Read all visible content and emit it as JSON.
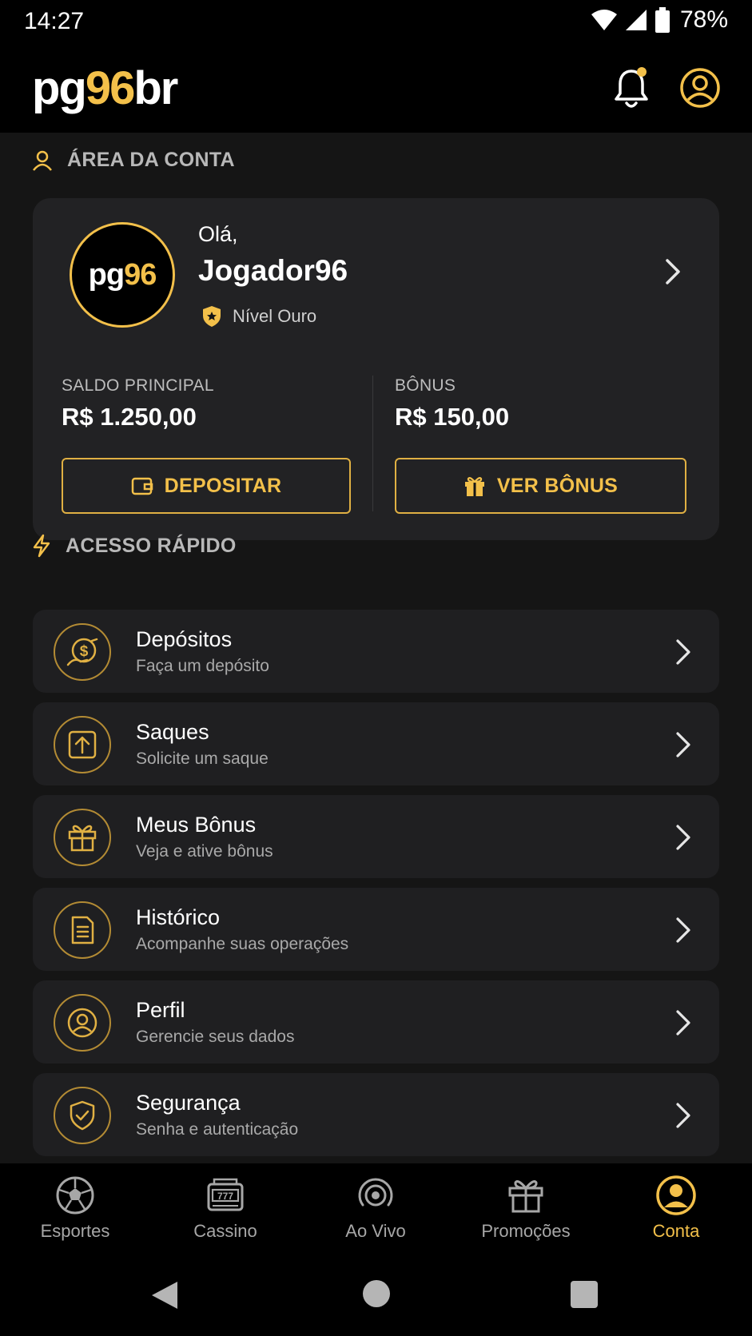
{
  "status": {
    "time": "14:27",
    "battery": "78%"
  },
  "app": {
    "logo_a": "pg",
    "logo_b": "96",
    "logo_c": "br"
  },
  "colors": {
    "accent": "#f3c04a",
    "background": "#151515",
    "card": "#222224"
  },
  "account": {
    "section_title": "ÁREA DA CONTA",
    "avatar_a": "pg",
    "avatar_b": "96",
    "greeting": "Olá,",
    "username": "Jogador96",
    "level": "Nível Ouro",
    "main_balance_label": "SALDO PRINCIPAL",
    "main_balance_value": "R$ 1.250,00",
    "bonus_label": "BÔNUS",
    "bonus_value": "R$ 150,00",
    "deposit_label": "DEPOSITAR",
    "view_bonus_label": "VER BÔNUS"
  },
  "quick": {
    "section_title": "ACESSO RÁPIDO",
    "items": [
      {
        "title": "Depósitos",
        "subtitle": "Faça um depósito",
        "icon": "deposit-coin-icon"
      },
      {
        "title": "Saques",
        "subtitle": "Solicite um saque",
        "icon": "withdraw-icon"
      },
      {
        "title": "Meus Bônus",
        "subtitle": "Veja e ative bônus",
        "icon": "gift-icon"
      },
      {
        "title": "Histórico",
        "subtitle": "Acompanhe suas operações",
        "icon": "document-icon"
      },
      {
        "title": "Perfil",
        "subtitle": "Gerencie seus dados",
        "icon": "user-icon"
      },
      {
        "title": "Segurança",
        "subtitle": "Senha e autenticação",
        "icon": "shield-check-icon"
      }
    ]
  },
  "nav": {
    "items": [
      {
        "label": "Esportes",
        "icon": "soccer-ball-icon"
      },
      {
        "label": "Cassino",
        "icon": "slot-machine-icon"
      },
      {
        "label": "Ao Vivo",
        "icon": "live-broadcast-icon"
      },
      {
        "label": "Promoções",
        "icon": "gift-icon"
      },
      {
        "label": "Conta",
        "icon": "account-icon"
      }
    ],
    "active": "Conta"
  }
}
